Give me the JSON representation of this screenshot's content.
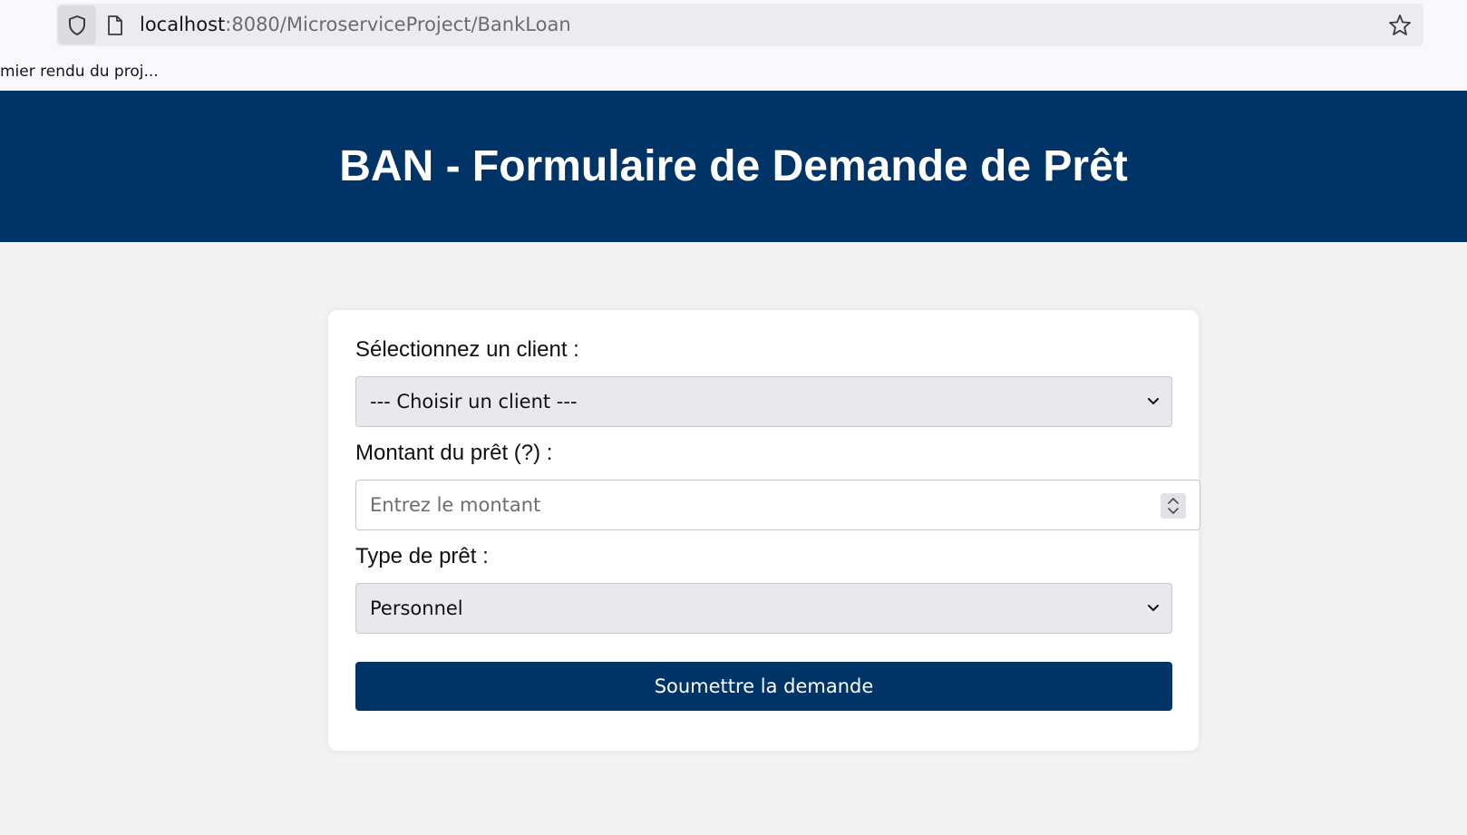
{
  "browser": {
    "url_host": "localhost",
    "url_path": ":8080/MicroserviceProject/BankLoan",
    "bookmark_text": "mier rendu du proj..."
  },
  "header": {
    "title": "BAN - Formulaire de Demande de Prêt"
  },
  "form": {
    "client_label": "Sélectionnez un client :",
    "client_selected": "--- Choisir un client ---",
    "amount_label": "Montant du prêt (?) :",
    "amount_placeholder": "Entrez le montant",
    "amount_value": "",
    "type_label": "Type de prêt :",
    "type_selected": "Personnel",
    "submit_label": "Soumettre la demande"
  },
  "colors": {
    "header_bg": "#003366",
    "page_bg": "#f3f3f3",
    "button_bg": "#003366"
  }
}
